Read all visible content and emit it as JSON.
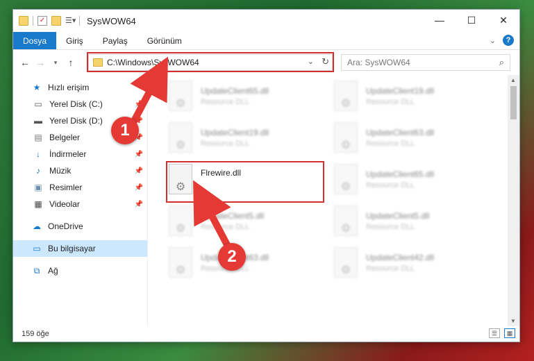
{
  "window": {
    "title": "SysWOW64"
  },
  "title_controls": {
    "minimize": "—",
    "maximize": "☐",
    "close": "✕"
  },
  "ribbon": {
    "tabs": [
      "Dosya",
      "Giriş",
      "Paylaş",
      "Görünüm"
    ]
  },
  "address": {
    "path": "C:\\Windows\\SysWOW64"
  },
  "search": {
    "placeholder": "Ara: SysWOW64"
  },
  "sidebar": {
    "quick_access": "Hızlı erişim",
    "items": [
      "Yerel Disk (C:)",
      "Yerel Disk (D:)",
      "Belgeler",
      "İndirmeler",
      "Müzik",
      "Resimler",
      "Videolar"
    ],
    "onedrive": "OneDrive",
    "this_pc": "Bu bilgisayar",
    "network": "Ağ"
  },
  "files": {
    "left": [
      {
        "name": "UpdateClient65.dll",
        "type": "Resource DLL"
      },
      {
        "name": "UpdateClient19.dll",
        "type": "Resource DLL"
      },
      {
        "name": "Flrewire.dll",
        "type": ""
      },
      {
        "name": "UpdateClient5.dll",
        "type": "Resource DLL"
      },
      {
        "name": "UpdateClient63.dll",
        "type": "Resource DLL"
      }
    ],
    "right": [
      {
        "name": "UpdateClient19.dll",
        "type": "Resource DLL"
      },
      {
        "name": "UpdateClient63.dll",
        "type": "Resource DLL"
      },
      {
        "name": "UpdateClient65.dll",
        "type": "Resource DLL"
      },
      {
        "name": "UpdateClient5.dll",
        "type": "Resource DLL"
      },
      {
        "name": "UpdateClient42.dll",
        "type": "Resource DLL"
      }
    ]
  },
  "status": {
    "count": "159 öğe"
  },
  "callouts": {
    "one": "1",
    "two": "2"
  }
}
